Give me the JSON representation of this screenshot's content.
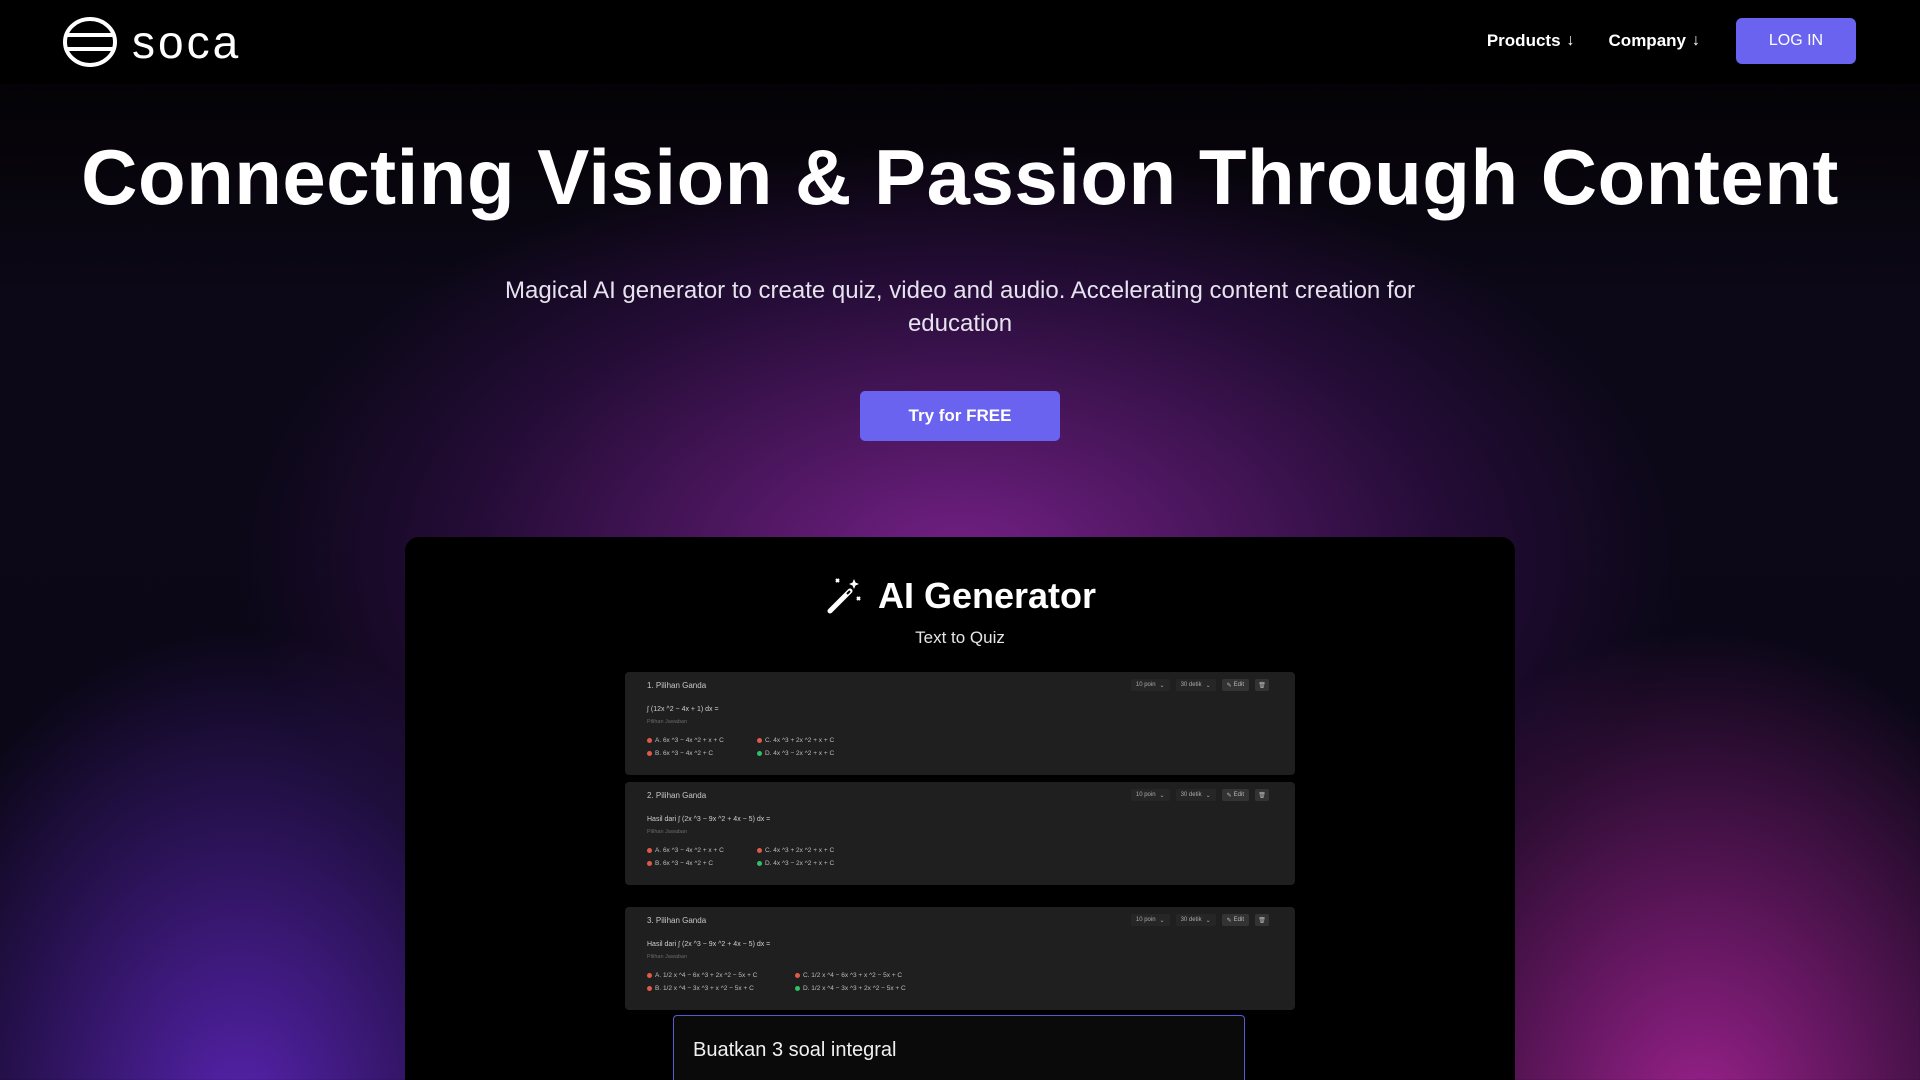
{
  "nav": {
    "logo_text": "soca",
    "links": [
      {
        "label": "Products",
        "arrow": "↓"
      },
      {
        "label": "Company",
        "arrow": "↓"
      }
    ],
    "login_label": "LOG IN"
  },
  "hero": {
    "title": "Connecting Vision & Passion Through Content",
    "subtitle": "Magical AI generator to create quiz, video and audio. Accelerating content creation for education",
    "cta_label": "Try for FREE"
  },
  "generator": {
    "title": "AI Generator",
    "subtitle": "Text to Quiz",
    "questions": [
      {
        "title": "1. Pilihan Ganda",
        "points": "10 poin",
        "time": "30 detik",
        "edit_label": "Edit",
        "text": "∫ (12x ^2 − 4x + 1) dx =",
        "hint": "Pilihan Jawaban",
        "options": [
          {
            "text": "A. 6x ^3 − 4x ^2 + x + C",
            "correct": false
          },
          {
            "text": "B. 6x ^3 − 4x ^2 + C",
            "correct": false
          },
          {
            "text": "C. 4x ^3 + 2x ^2 + x + C",
            "correct": false
          },
          {
            "text": "D. 4x ^3 − 2x ^2 + x + C",
            "correct": true
          }
        ]
      },
      {
        "title": "2. Pilihan Ganda",
        "points": "10 poin",
        "time": "30 detik",
        "edit_label": "Edit",
        "text": "Hasil dari ∫ (2x ^3 − 9x ^2 + 4x − 5) dx =",
        "hint": "Pilihan Jawaban",
        "options": [
          {
            "text": "A. 6x ^3 − 4x ^2 + x + C",
            "correct": false
          },
          {
            "text": "B. 6x ^3 − 4x ^2 + C",
            "correct": false
          },
          {
            "text": "C. 4x ^3 + 2x ^2 + x + C",
            "correct": false
          },
          {
            "text": "D. 4x ^3 − 2x ^2 + x + C",
            "correct": true
          }
        ]
      },
      {
        "title": "3. Pilihan Ganda",
        "points": "10 poin",
        "time": "30 detik",
        "edit_label": "Edit",
        "text": "Hasil dari ∫ (2x ^3 − 9x ^2 + 4x − 5) dx =",
        "hint": "Pilihan Jawaban",
        "options": [
          {
            "text": "A. 1/2 x ^4 − 6x ^3 + 2x ^2 − 5x + C",
            "correct": false
          },
          {
            "text": "B. 1/2 x ^4 − 3x ^3 + x ^2 − 5x + C",
            "correct": false
          },
          {
            "text": "C. 1/2 x ^4 − 6x ^3 + x ^2 − 5x + C",
            "correct": false
          },
          {
            "text": "D. 1/2 x ^4 − 3x ^3 + 2x ^2 − 5x + C",
            "correct": true
          }
        ]
      }
    ],
    "prompt_value": "Buatkan 3 soal integral"
  },
  "colors": {
    "accent": "#6a63f0",
    "prompt_border": "#5b58d8",
    "wrong_dot": "#e05a4b",
    "correct_dot": "#2fc06a"
  },
  "icons": {
    "logo": "soca-logo-icon",
    "generator": "magic-wand-icon",
    "delete": "trash-icon",
    "edit": "pencil-icon"
  }
}
